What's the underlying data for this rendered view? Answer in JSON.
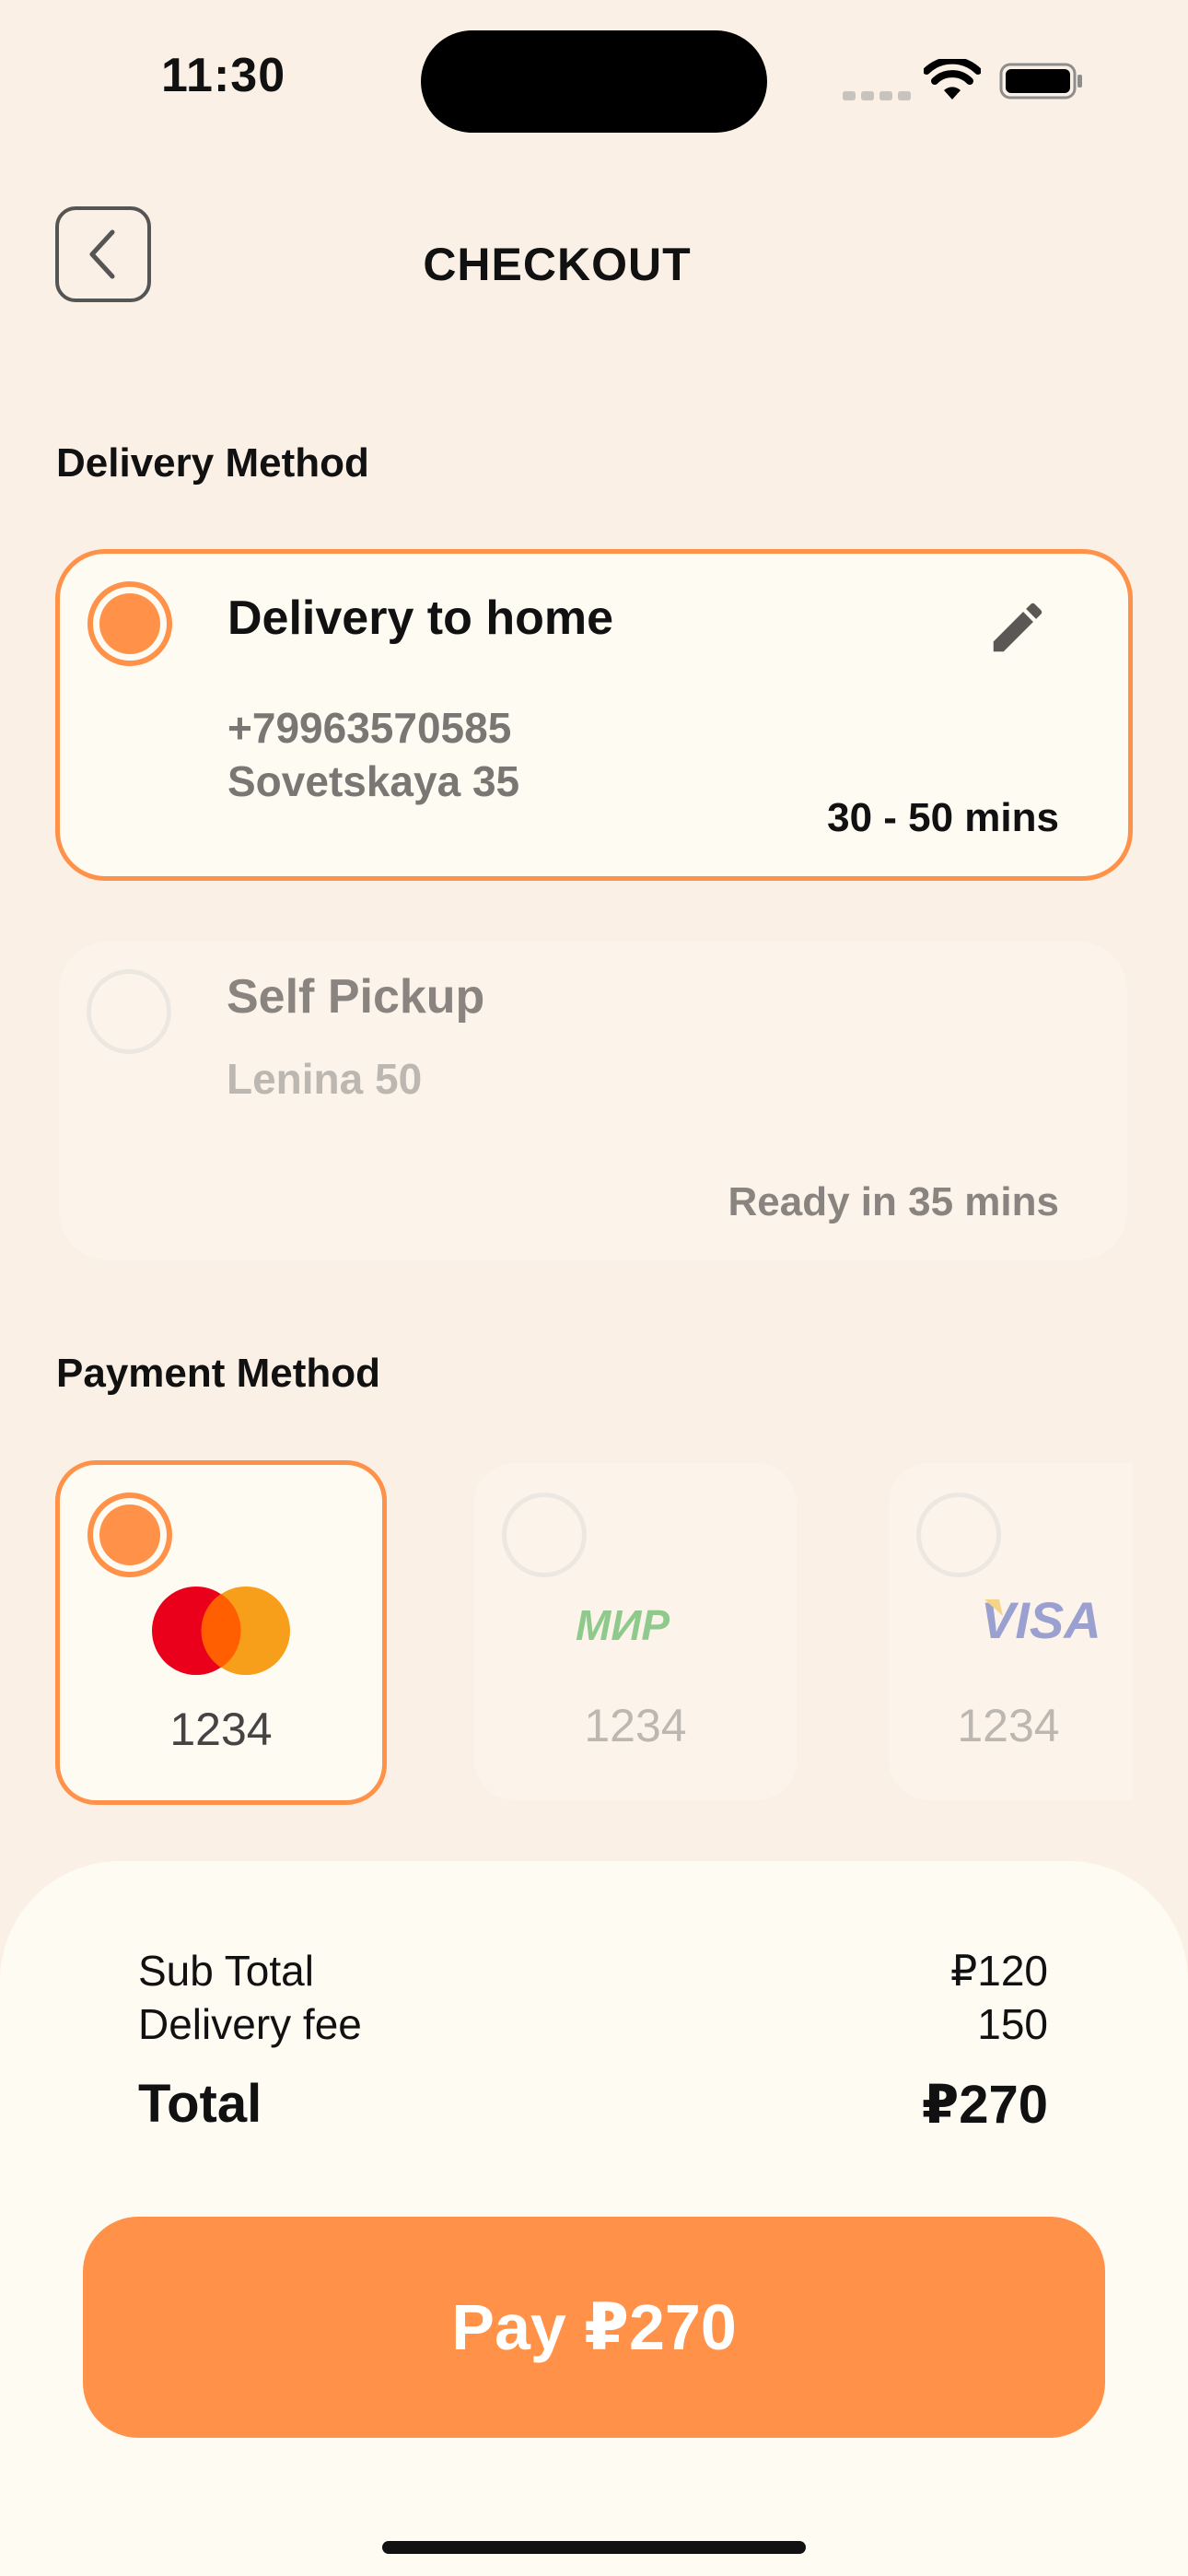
{
  "status_bar": {
    "time": "11:30"
  },
  "header": {
    "title": "CHECKOUT"
  },
  "delivery": {
    "section_label": "Delivery Method",
    "options": [
      {
        "title": "Delivery to home",
        "phone": "+79963570585",
        "address": "Sovetskaya 35",
        "time": "30 - 50 mins",
        "selected": true
      },
      {
        "title": "Self Pickup",
        "address": "Lenina 50",
        "time": "Ready in 35 mins",
        "selected": false
      }
    ]
  },
  "payment": {
    "section_label": "Payment Method",
    "cards": [
      {
        "brand": "mastercard",
        "digits": "1234",
        "selected": true
      },
      {
        "brand": "МИР",
        "digits": "1234",
        "selected": false
      },
      {
        "brand": "VISA",
        "digits": "1234",
        "selected": false
      }
    ]
  },
  "summary": {
    "subtotal_label": "Sub Total",
    "subtotal_value": "₽120",
    "delivery_label": "Delivery fee",
    "delivery_value": "150",
    "total_label": "Total",
    "total_value": "₽270"
  },
  "pay_button": {
    "label": "Pay ₽270"
  },
  "colors": {
    "accent": "#FF9148",
    "background": "#FAF0E6",
    "card": "#FEFBF3"
  }
}
